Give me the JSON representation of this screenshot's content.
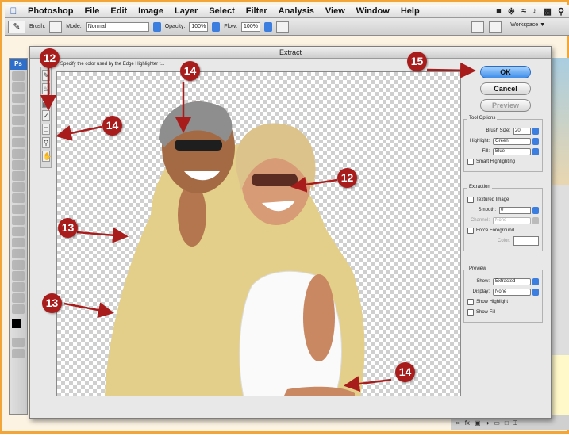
{
  "menubar": {
    "app": "Photoshop",
    "items": [
      "File",
      "Edit",
      "Image",
      "Layer",
      "Select",
      "Filter",
      "Analysis",
      "View",
      "Window",
      "Help"
    ]
  },
  "options": {
    "brush_label": "Brush:",
    "mode_label": "Mode:",
    "mode_value": "Normal",
    "opacity_label": "Opacity:",
    "opacity_value": "100%",
    "flow_label": "Flow:",
    "flow_value": "100%",
    "workspace_label": "Workspace ▼"
  },
  "toolbox": {
    "badge": "Ps"
  },
  "dialog": {
    "title": "Extract",
    "hint": "Specify the color used by the Edge Highlighter t...",
    "ok": "OK",
    "cancel": "Cancel",
    "preview_btn": "Preview",
    "tool_options": {
      "legend": "Tool Options",
      "brush_size_label": "Brush Size:",
      "brush_size_value": "20",
      "highlight_label": "Highlight:",
      "highlight_value": "Green",
      "fill_label": "Fill:",
      "fill_value": "Blue",
      "smart_label": "Smart Highlighting"
    },
    "extraction": {
      "legend": "Extraction",
      "textured_label": "Textured Image",
      "smooth_label": "Smooth:",
      "smooth_value": "0",
      "channel_label": "Channel:",
      "channel_value": "None",
      "force_label": "Force Foreground",
      "color_label": "Color:"
    },
    "preview": {
      "legend": "Preview",
      "show_label": "Show:",
      "show_value": "Extracted",
      "display_label": "Display:",
      "display_value": "None",
      "show_highlight_label": "Show Highlight",
      "show_fill_label": "Show Fill"
    }
  },
  "callouts": [
    "12",
    "14",
    "14",
    "12",
    "13",
    "13",
    "14",
    "15"
  ],
  "colors": {
    "callout": "#a91c1c",
    "ok_button": "#3f8ee9",
    "frame": "#f2a63a"
  }
}
